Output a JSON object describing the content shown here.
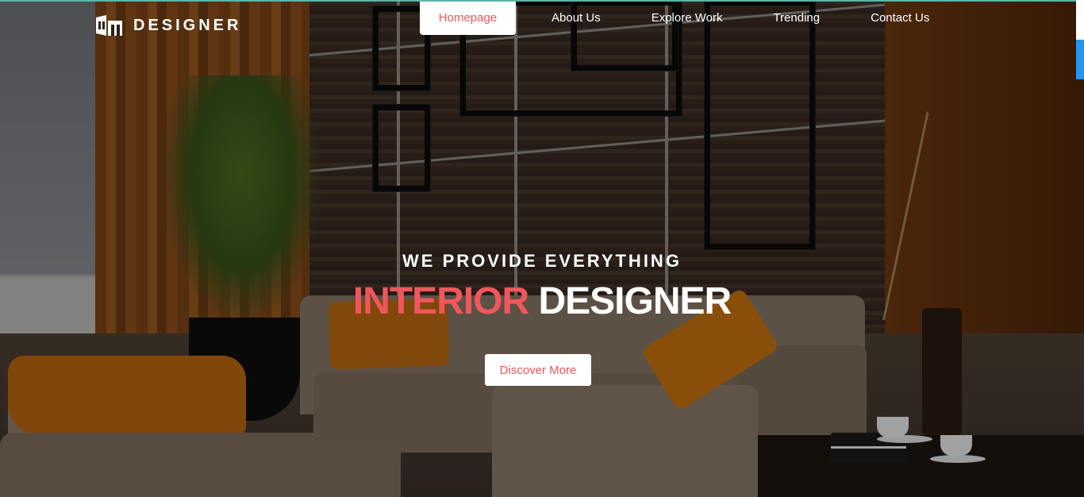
{
  "brand": {
    "logo_text": "DESIGNER",
    "logo_icon": "building-logo-icon"
  },
  "nav": {
    "items": [
      {
        "label": "Homepage",
        "active": true
      },
      {
        "label": "About Us",
        "active": false
      },
      {
        "label": "Explore Work",
        "active": false
      },
      {
        "label": "Trending",
        "active": false
      },
      {
        "label": "Contact Us",
        "active": false
      }
    ]
  },
  "hero": {
    "subtitle": "WE PROVIDE EVERYTHING",
    "title_accent": "INTERIOR",
    "title_main": "DESIGNER",
    "cta_label": "Discover More"
  },
  "colors": {
    "accent": "#f0575c",
    "white": "#ffffff",
    "scrollbar": "#2196f3",
    "top_line": "#5bb6a9"
  }
}
